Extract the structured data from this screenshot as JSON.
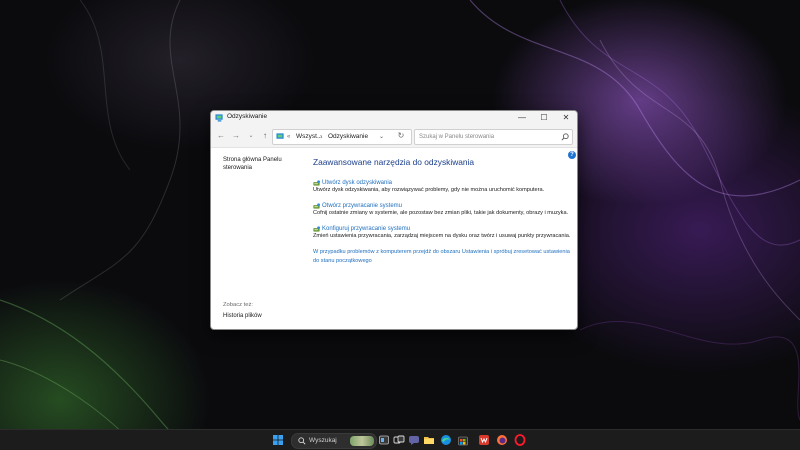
{
  "window": {
    "title": "Odzyskiwanie",
    "controls": {
      "minimize": "—",
      "maximize": "☐",
      "close": "✕"
    }
  },
  "navigation": {
    "back": "←",
    "forward": "→",
    "recent": "⌄",
    "up": "↑",
    "address": {
      "prefix": "«",
      "segments": [
        "Wszyst...",
        "Odzyskiwanie"
      ],
      "separator": "›",
      "dropdown": "⌄"
    },
    "refresh": "↻",
    "search_placeholder": "Szukaj w Panelu sterowania"
  },
  "help": "?",
  "left_pane": {
    "home_link": "Strona główna Panelu sterowania",
    "see_also_label": "Zobacz też:",
    "see_also_items": [
      "Historia plików"
    ]
  },
  "main": {
    "heading": "Zaawansowane narzędzia do odzyskiwania",
    "tasks": [
      {
        "link": "Utwórz dysk odzyskiwania",
        "description": "Utwórz dysk odzyskiwania, aby rozwiązywać problemy, gdy nie można uruchomić komputera."
      },
      {
        "link": "Otwórz przywracanie systemu",
        "description": "Cofnij ostatnie zmiany w systemie, ale pozostaw bez zmian pliki, takie jak dokumenty, obrazy i muzyka."
      },
      {
        "link": "Konfiguruj przywracanie systemu",
        "description": "Zmień ustawienia przywracania, zarządzaj miejscem na dysku oraz twórz i usuwaj punkty przywracania."
      }
    ],
    "reset_link": "W przypadku problemów z komputerem przejdź do obszaru Ustawienia i spróbuj zresetować ustawienia do stanu początkowego"
  },
  "taskbar": {
    "search_text": "Wyszukaj",
    "items": [
      "windows-start",
      "search",
      "widgets",
      "task-view",
      "teams-chat",
      "file-explorer",
      "edge",
      "microsoft-store",
      "wps-office",
      "firefox",
      "opera"
    ]
  },
  "colors": {
    "accent_link": "#1f6fbf",
    "heading": "#1a3e8c",
    "taskbar": "#1c1c1c"
  }
}
